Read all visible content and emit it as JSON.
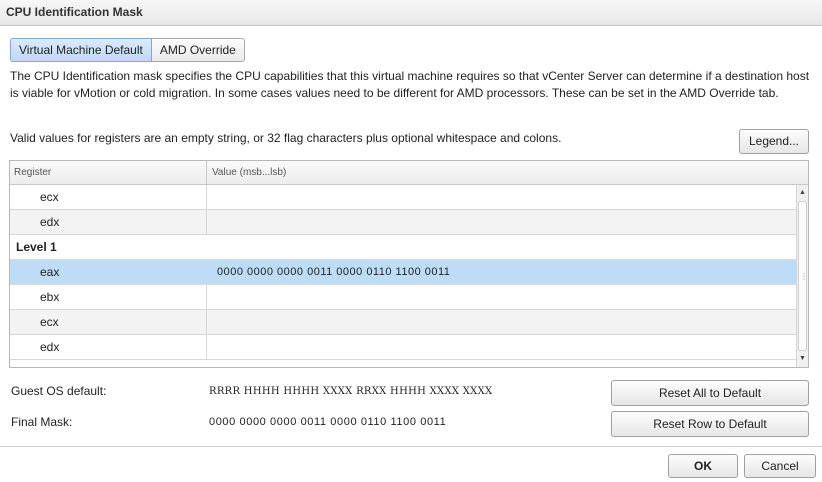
{
  "window": {
    "title": "CPU Identification Mask"
  },
  "tabs": [
    {
      "label": "Virtual Machine Default",
      "active": true
    },
    {
      "label": "AMD Override",
      "active": false
    }
  ],
  "description": "The CPU Identification mask specifies the CPU capabilities that this virtual machine requires so that vCenter Server can determine if a destination host is viable for vMotion or cold migration. In some cases values need to be different for AMD processors. These can be set in the AMD Override tab.",
  "valid_values_text": "Valid values for registers are an empty string, or 32 flag characters plus optional whitespace and colons.",
  "legend_button": "Legend...",
  "grid": {
    "columns": {
      "register": "Register",
      "value": "Value (msb...lsb)"
    },
    "rows": [
      {
        "kind": "register",
        "register": "ecx",
        "value": ""
      },
      {
        "kind": "register",
        "register": "edx",
        "value": ""
      },
      {
        "kind": "level",
        "label": "Level 1"
      },
      {
        "kind": "register",
        "register": "eax",
        "value": "0000  0000  0000  0011  0000  0110  1100  0011",
        "selected": true
      },
      {
        "kind": "register",
        "register": "ebx",
        "value": ""
      },
      {
        "kind": "register",
        "register": "ecx",
        "value": ""
      },
      {
        "kind": "register",
        "register": "edx",
        "value": ""
      }
    ]
  },
  "guest_os_default": {
    "label": "Guest OS default:",
    "value": "RRRR  HHHH  HHHH  XXXX  RRXX  HHHH  XXXX  XXXX"
  },
  "final_mask": {
    "label": "Final Mask:",
    "value": "0000  0000  0000  0011  0000  0110  1100  0011"
  },
  "buttons": {
    "reset_all": "Reset All to Default",
    "reset_row": "Reset Row to Default",
    "ok": "OK",
    "cancel": "Cancel"
  },
  "colors": {
    "selected_row": "#bcdcf8",
    "active_tab": "#cfe3f8"
  }
}
